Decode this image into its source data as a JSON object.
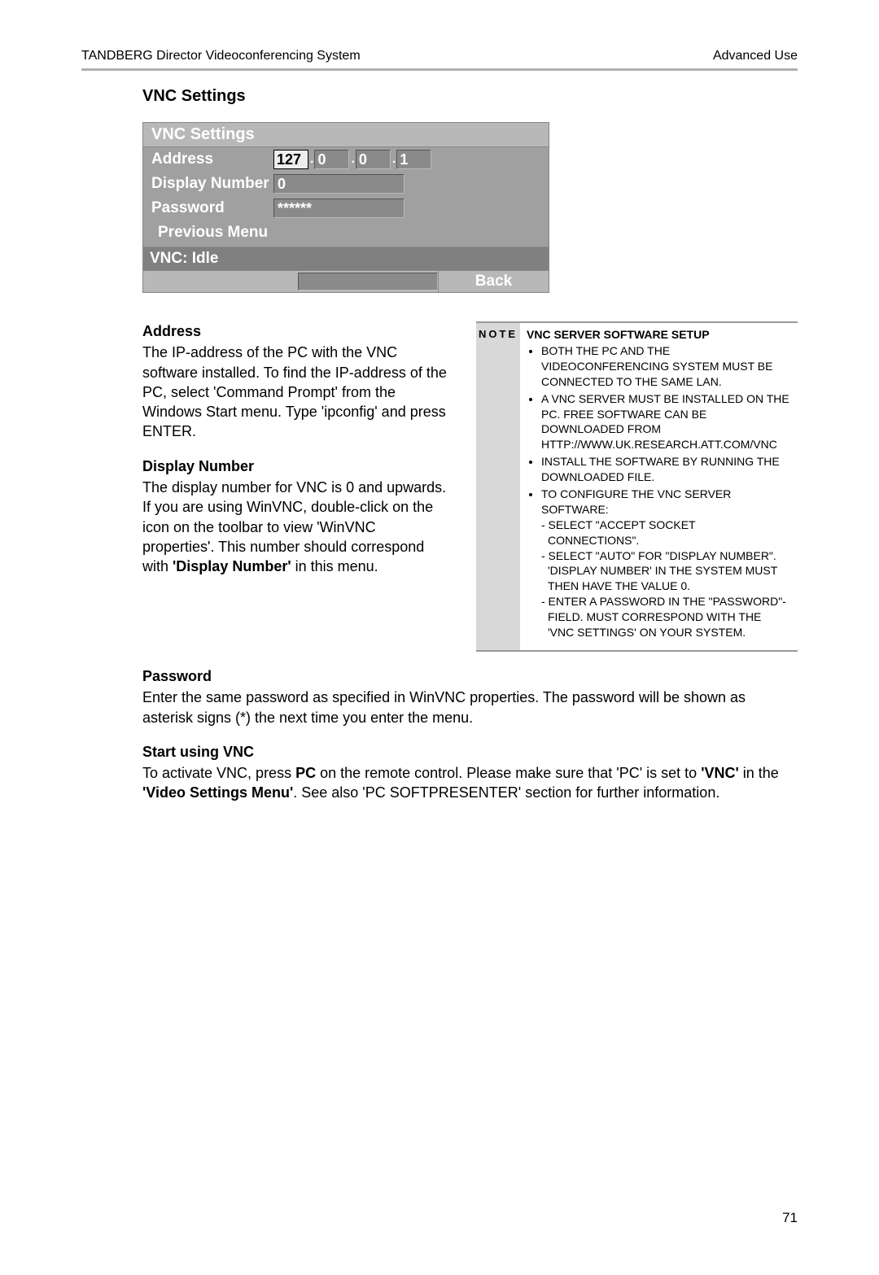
{
  "header": {
    "left": "TANDBERG Director Videoconferencing System",
    "right": "Advanced Use"
  },
  "section_title": "VNC Settings",
  "ui": {
    "title": "VNC Settings",
    "rows": {
      "address": {
        "label": "Address",
        "octet1": "127",
        "octet2": "0",
        "octet3": "0",
        "octet4": "1",
        "dot": "."
      },
      "display_number": {
        "label": "Display Number",
        "value": "0"
      },
      "password": {
        "label": "Password",
        "value": "******"
      },
      "previous_menu": "Previous Menu"
    },
    "status": "VNC: Idle",
    "back_label": "Back"
  },
  "left_col": {
    "address": {
      "heading": "Address",
      "text": "The IP-address of the PC with the VNC software installed. To find the IP-address of the PC, select 'Command Prompt' from the Windows Start menu. Type 'ipconfig' and press ENTER."
    },
    "display_number": {
      "heading": "Display Number",
      "text_before": "The display number for VNC is 0 and upwards. If you are using WinVNC, double-click on the icon on the toolbar to view 'WinVNC properties'. This number should correspond with ",
      "bold": "'Display Number'",
      "text_after": " in this menu."
    }
  },
  "note": {
    "label": "NOTE",
    "title": "VNC SERVER SOFTWARE SETUP",
    "bullets": {
      "b1": "BOTH THE PC AND THE VIDEOCONFERENCING SYSTEM MUST BE CONNECTED TO THE SAME LAN.",
      "b2a": "A VNC SERVER MUST BE INSTALLED ON THE PC. FREE SOFTWARE CAN BE DOWNLOADED FROM HTTP://WWW.UK.RESEARCH.ATT.COM/VNC",
      "b3": "INSTALL THE SOFTWARE BY RUNNING THE DOWNLOADED FILE.",
      "b4": "TO CONFIGURE THE VNC SERVER SOFTWARE:",
      "b4a": "- SELECT \"ACCEPT SOCKET CONNECTIONS\".",
      "b4b": "- SELECT \"AUTO\" FOR \"DISPLAY NUMBER\". 'DISPLAY NUMBER' IN THE SYSTEM MUST THEN HAVE THE VALUE 0.",
      "b4c": "- ENTER A PASSWORD IN THE \"PASSWORD\"-FIELD. MUST CORRESPOND WITH THE 'VNC SETTINGS' ON YOUR SYSTEM."
    }
  },
  "password_section": {
    "heading": "Password",
    "text": "Enter the same password as specified in WinVNC properties. The password will be shown as asterisk signs (*) the next time you enter the menu."
  },
  "start_section": {
    "heading": "Start using VNC",
    "p1": "To activate VNC, press ",
    "p1b": "PC",
    "p2": " on the remote control. Please make sure that 'PC' is set to ",
    "p2b": "'VNC'",
    "p3": " in the ",
    "p3b": "'Video Settings Menu'",
    "p4": ". See also 'PC S",
    "p4sc": "OFT",
    "p4mid": "P",
    "p4sc2": "RESENTER",
    "p5": "' section for further information."
  },
  "page_number": "71"
}
